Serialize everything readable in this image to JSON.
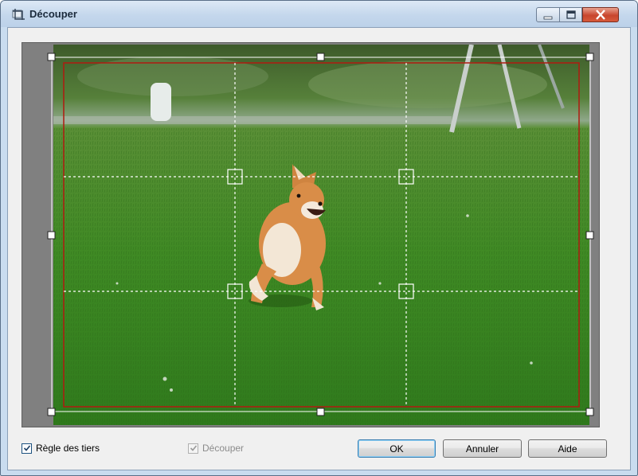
{
  "window": {
    "title": "Découper",
    "app_icon": "crop-app-icon",
    "controls": [
      "minimize",
      "maximize",
      "close"
    ]
  },
  "options": {
    "rule_of_thirds": {
      "label": "Règle des tiers",
      "checked": true,
      "enabled": true
    },
    "crop": {
      "label": "Découper",
      "checked": true,
      "enabled": false
    }
  },
  "buttons": {
    "ok": "OK",
    "cancel": "Annuler",
    "help": "Aide"
  },
  "colors": {
    "crop_frame": "#b01a10",
    "grid": "#ffffff",
    "preview_bg": "#808080"
  }
}
